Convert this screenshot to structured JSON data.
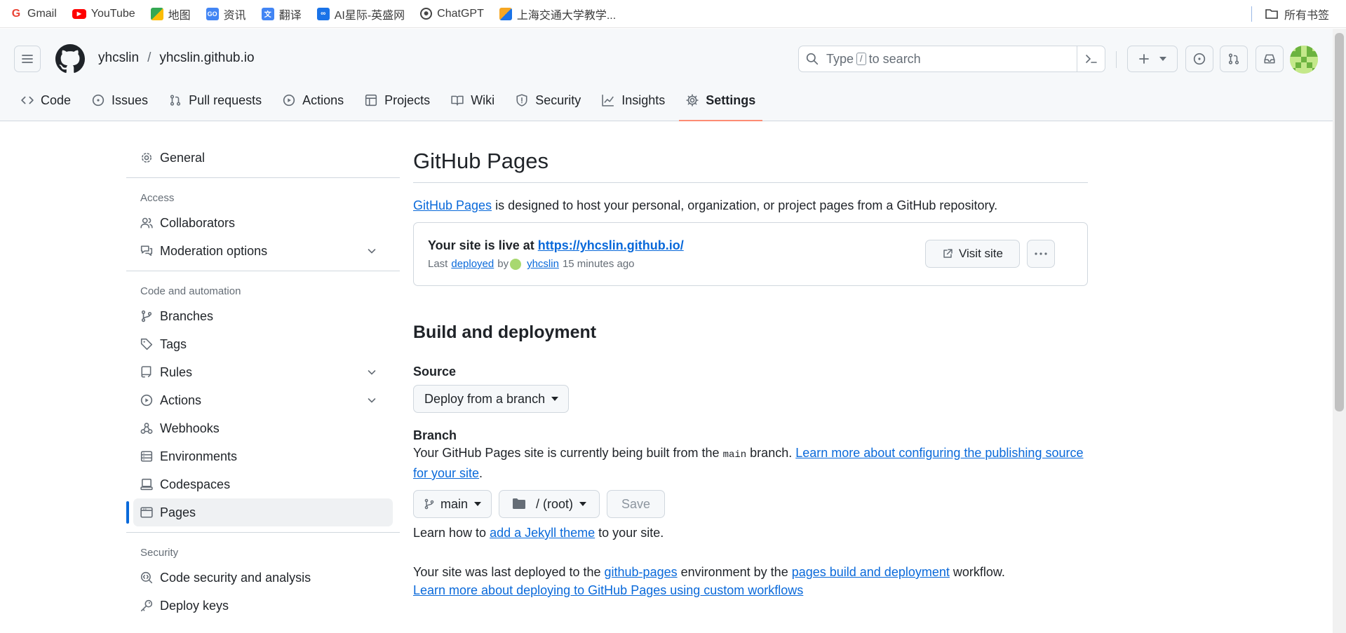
{
  "bookmarks": {
    "items": [
      {
        "label": "Gmail",
        "icon": "gmail-icon",
        "color": "#ea4335"
      },
      {
        "label": "YouTube",
        "icon": "youtube-icon",
        "color": "#ff0000"
      },
      {
        "label": "地图",
        "icon": "maps-icon",
        "color": "#34a853"
      },
      {
        "label": "资讯",
        "icon": "news-icon",
        "color": "#4285f4"
      },
      {
        "label": "翻译",
        "icon": "translate-icon",
        "color": "#4285f4"
      },
      {
        "label": "AI星际-英盛网",
        "icon": "ai-icon",
        "color": "#1a73e8"
      },
      {
        "label": "ChatGPT",
        "icon": "chatgpt-icon",
        "color": "#444444"
      },
      {
        "label": "上海交通大学教学...",
        "icon": "sjtu-icon",
        "color": "#f5a623"
      }
    ],
    "all_bookmarks": "所有书签"
  },
  "header": {
    "owner": "yhcslin",
    "separator": "/",
    "repo": "yhcslin.github.io",
    "search": {
      "prefix": "Type",
      "key": "/",
      "suffix": "to search"
    }
  },
  "tabs": [
    {
      "label": "Code",
      "icon": "code-icon"
    },
    {
      "label": "Issues",
      "icon": "issue-icon"
    },
    {
      "label": "Pull requests",
      "icon": "pull-request-icon"
    },
    {
      "label": "Actions",
      "icon": "play-icon"
    },
    {
      "label": "Projects",
      "icon": "table-icon"
    },
    {
      "label": "Wiki",
      "icon": "book-icon"
    },
    {
      "label": "Security",
      "icon": "shield-icon"
    },
    {
      "label": "Insights",
      "icon": "graph-icon"
    },
    {
      "label": "Settings",
      "icon": "gear-icon",
      "active": true
    }
  ],
  "sidebar": {
    "general": "General",
    "access_heading": "Access",
    "access": [
      {
        "label": "Collaborators"
      },
      {
        "label": "Moderation options",
        "expandable": true
      }
    ],
    "code_heading": "Code and automation",
    "code": [
      {
        "label": "Branches"
      },
      {
        "label": "Tags"
      },
      {
        "label": "Rules",
        "expandable": true
      },
      {
        "label": "Actions",
        "expandable": true
      },
      {
        "label": "Webhooks"
      },
      {
        "label": "Environments"
      },
      {
        "label": "Codespaces"
      },
      {
        "label": "Pages",
        "active": true
      }
    ],
    "security_heading": "Security",
    "security": [
      {
        "label": "Code security and analysis"
      },
      {
        "label": "Deploy keys"
      }
    ]
  },
  "main": {
    "title": "GitHub Pages",
    "intro_link": "GitHub Pages",
    "intro_text": " is designed to host your personal, organization, or project pages from a GitHub repository.",
    "live": {
      "prefix": "Your site is live at ",
      "url": "https://yhcslin.github.io/",
      "meta_last": "Last",
      "meta_deployed": "deployed",
      "meta_by": "by",
      "meta_user": "yhcslin",
      "meta_time": "15 minutes ago",
      "visit_label": "Visit site"
    },
    "build_title": "Build and deployment",
    "source_label": "Source",
    "source_value": "Deploy from a branch",
    "branch_label": "Branch",
    "branch_desc_pre": "Your GitHub Pages site is currently being built from the ",
    "branch_desc_code": "main",
    "branch_desc_mid": " branch. ",
    "branch_desc_link": "Learn more about configuring the publishing source for your site",
    "branch_desc_end": ".",
    "branch_select": "main",
    "folder_select": "/ (root)",
    "save_label": "Save",
    "jekyll_pre": "Learn how to ",
    "jekyll_link": "add a Jekyll theme",
    "jekyll_post": " to your site.",
    "deployed_pre": "Your site was last deployed to the ",
    "deployed_env": "github-pages",
    "deployed_mid": " environment by the ",
    "deployed_workflow": "pages build and deployment",
    "deployed_post": " workflow.",
    "custom_workflows_link": "Learn more about deploying to GitHub Pages using custom workflows"
  },
  "colors": {
    "accent_link": "#0969da",
    "active_tab_underline": "#fd8c73",
    "active_side_marker": "#0969da"
  }
}
